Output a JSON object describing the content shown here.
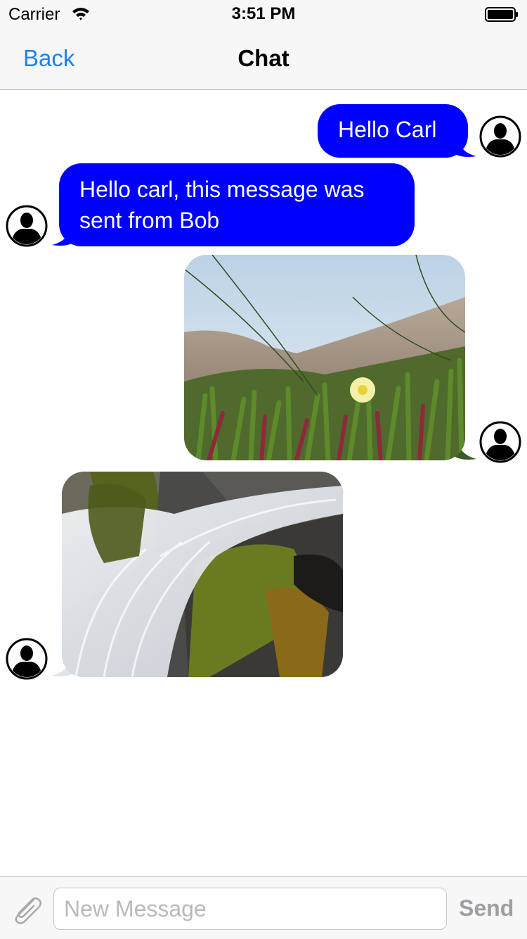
{
  "status_bar": {
    "carrier": "Carrier",
    "time": "3:51 PM"
  },
  "nav": {
    "back_label": "Back",
    "title": "Chat"
  },
  "messages": [
    {
      "direction": "outgoing",
      "type": "text",
      "text": "Hello Carl"
    },
    {
      "direction": "incoming",
      "type": "text",
      "lines": [
        "Hello carl, this message was",
        "sent from Bob"
      ]
    },
    {
      "direction": "outgoing",
      "type": "photo",
      "subject": "beach ice plant with yellow flower"
    },
    {
      "direction": "incoming",
      "type": "photo",
      "subject": "waterfall over mossy rocks"
    }
  ],
  "input": {
    "placeholder": "New Message",
    "send_label": "Send"
  },
  "colors": {
    "bubble": "#0000ff",
    "tint": "#1a82f0",
    "send_disabled": "#9e9ea3"
  }
}
